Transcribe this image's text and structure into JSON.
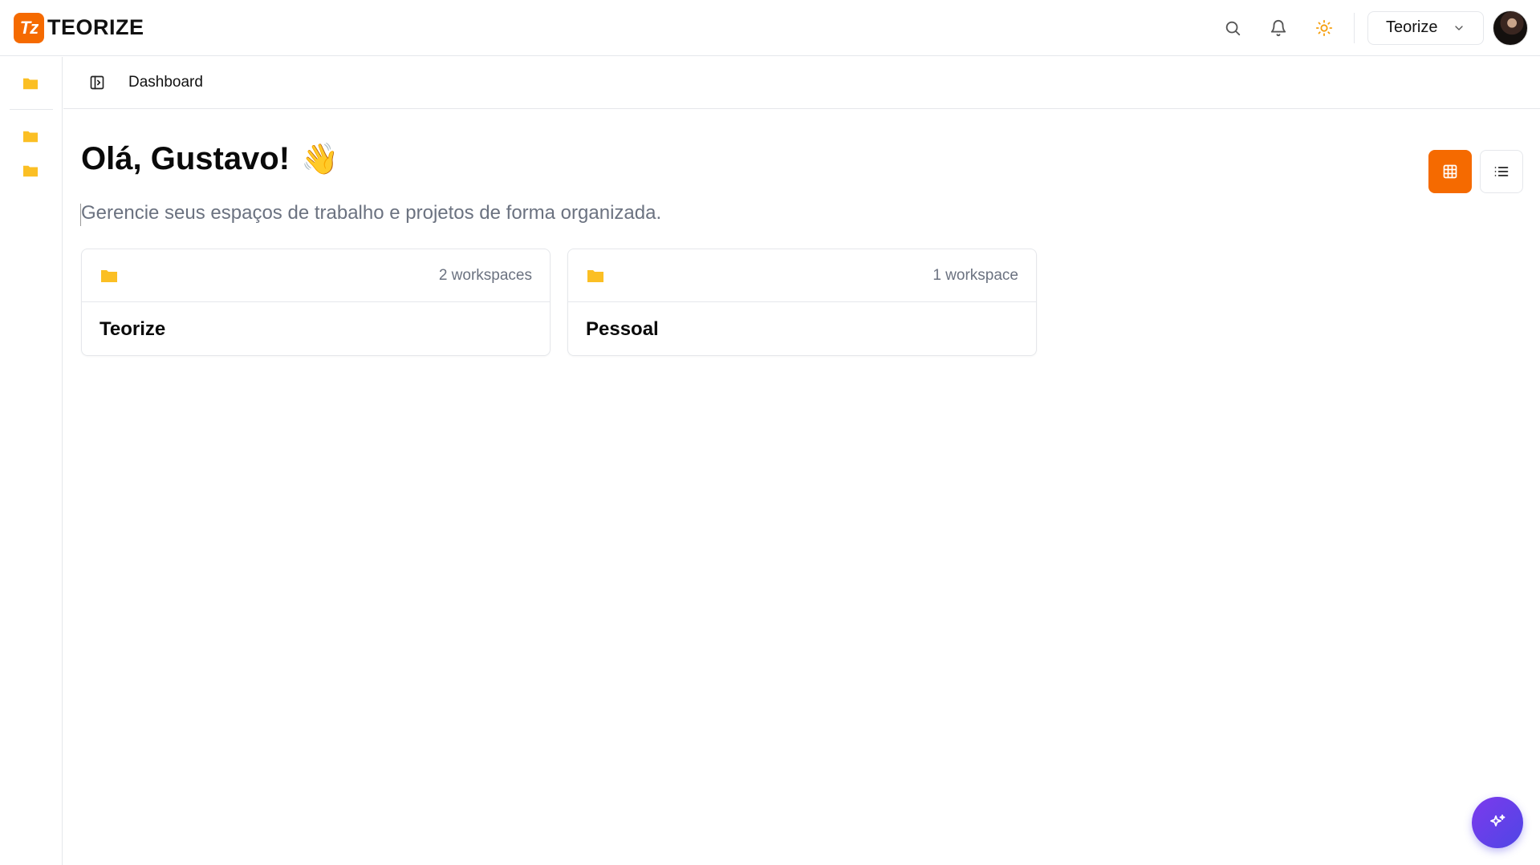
{
  "brand": {
    "mark": "Tz",
    "name": "TEORIZE",
    "accent": "#f56a00"
  },
  "topbar": {
    "org_selector": {
      "label": "Teorize"
    },
    "icons": [
      "search-icon",
      "bell-icon",
      "sun-icon",
      "chevron-down-icon"
    ]
  },
  "rail": {
    "items": [
      "folder-icon",
      "folder-icon",
      "folder-icon"
    ],
    "folder_color": "#fbbf24"
  },
  "breadcrumb": {
    "current": "Dashboard"
  },
  "main": {
    "greeting": "Olá, Gustavo!",
    "greeting_emoji": "👋",
    "subtitle": "Gerencie seus espaços de trabalho e projetos de forma organizada."
  },
  "view_toggle": {
    "active": "grid",
    "options": [
      "grid",
      "list"
    ]
  },
  "cards": [
    {
      "title": "Teorize",
      "count": "2 workspaces"
    },
    {
      "title": "Pessoal",
      "count": "1 workspace"
    }
  ],
  "fab": {
    "icon": "sparkles-icon",
    "colors": [
      "#7c3aed",
      "#4f46e5"
    ]
  }
}
